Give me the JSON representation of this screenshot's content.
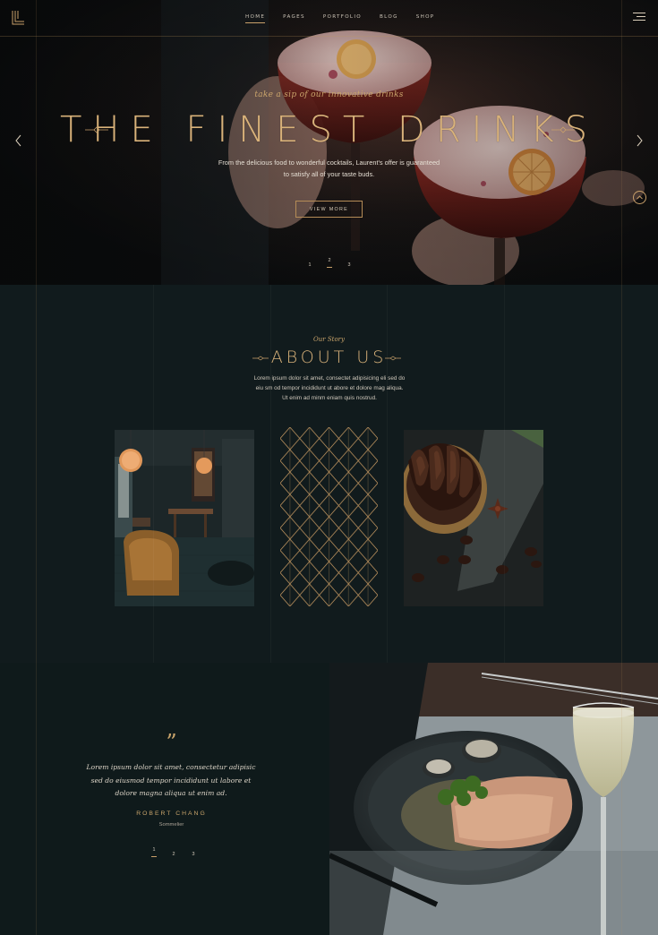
{
  "nav": {
    "items": [
      {
        "label": "HOME",
        "active": true
      },
      {
        "label": "PAGES"
      },
      {
        "label": "PORTFOLIO"
      },
      {
        "label": "BLOG"
      },
      {
        "label": "SHOP"
      }
    ],
    "logo_icon": "logo-ll-monogram",
    "menu_icon": "hamburger-menu-icon"
  },
  "hero": {
    "kicker": "take a sip of our innovative drinks",
    "title": "THE FINEST DRINKS",
    "subtitle_line1": "From the delicious food to wonderful cocktails, Laurent's offer is guaranteed",
    "subtitle_line2": "to satisfy all of your taste buds.",
    "button_label": "VIEW MORE",
    "pager": [
      "1",
      "2",
      "3"
    ],
    "pager_active": 2,
    "image": "two-red-cocktails-with-orange-slices"
  },
  "about": {
    "kicker": "Our Story",
    "title": "ABOUT US",
    "text_line1": "Lorem ipsum dolor sit amet, consectet adipisicing eli sed do",
    "text_line2": "eiu sm od tempor incididunt ut abore et dolore mag aliqua.",
    "text_line3": "Ut enim ad minm eniam quis nostrud.",
    "images": [
      "restaurant-interior-with-lamps",
      "gold-geometric-pattern",
      "chocolate-tart-with-coffee-beans"
    ]
  },
  "testimonial": {
    "text_line1": "Lorem ipsum dolor sit amet, consectetur adipisic",
    "text_line2": "sed do eiusmod tempor incididunt ut labore et",
    "text_line3": "dolore magna aliqua ut enim ad.",
    "name": "ROBERT CHANG",
    "role": "Sommelier",
    "pager": [
      "1",
      "2",
      "3"
    ],
    "pager_active": 1,
    "image": "plated-meat-with-clams-and-wine-glass"
  },
  "colors": {
    "gold": "#c9a06a",
    "background": "#111b1d",
    "text": "#cfc8bc"
  }
}
